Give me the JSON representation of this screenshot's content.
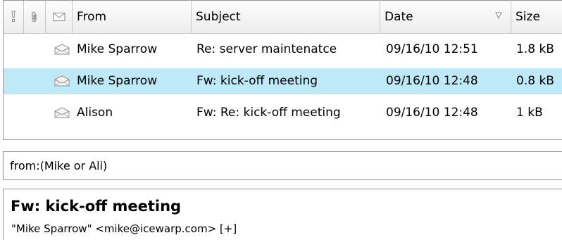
{
  "list": {
    "columns": {
      "importance_icon": "exclamation-icon",
      "attachment_icon": "paperclip-icon",
      "read_icon": "envelope-icon",
      "from": "From",
      "subject": "Subject",
      "date": "Date",
      "size": "Size",
      "sort_indicator": "sort-descending-icon"
    },
    "messages": [
      {
        "from": "Mike Sparrow",
        "subject": "Re: server maintenatce",
        "date": "09/16/10 12:51",
        "size": "1.8 kB",
        "selected": false
      },
      {
        "from": "Mike Sparrow",
        "subject": "Fw: kick-off meeting",
        "date": "09/16/10 12:48",
        "size": "0.8 kB",
        "selected": true
      },
      {
        "from": "Alison",
        "subject": "Fw: Re: kick-off meeting",
        "date": "09/16/10 12:48",
        "size": "1 kB",
        "selected": false
      }
    ],
    "selected_color": "#bfe9f6"
  },
  "search": {
    "value": "from:(Mike or Ali)"
  },
  "preview": {
    "subject": "Fw: kick-off meeting",
    "from_line": "\"Mike Sparrow\" <mike@icewarp.com>",
    "expand_label": "[+]"
  }
}
